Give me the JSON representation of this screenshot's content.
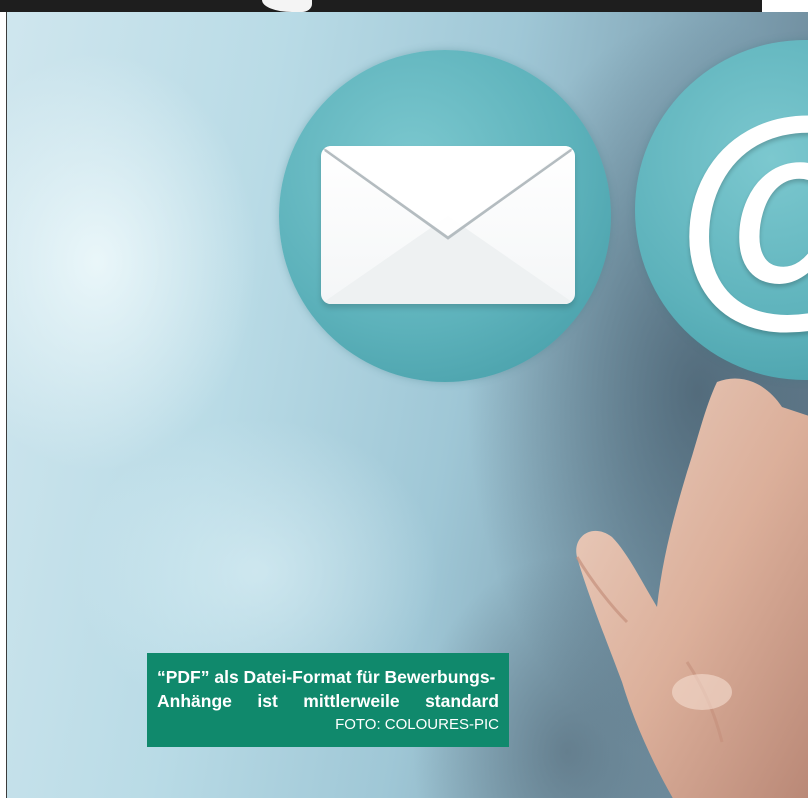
{
  "caption": {
    "line1": "“PDF” als Datei-Format für Bewerbungs-",
    "line2_words": [
      "Anhänge",
      "ist",
      "mittlerweile",
      "standard"
    ],
    "credit": "FOTO: COLOURES-PIC"
  },
  "icons": {
    "left_bubble": "envelope-icon",
    "right_bubble": "at-sign-icon",
    "at_glyph": "@"
  },
  "colors": {
    "caption_background": "#10896c",
    "bubble": "#5db2bb",
    "top_bar": "#1e1e1e"
  }
}
